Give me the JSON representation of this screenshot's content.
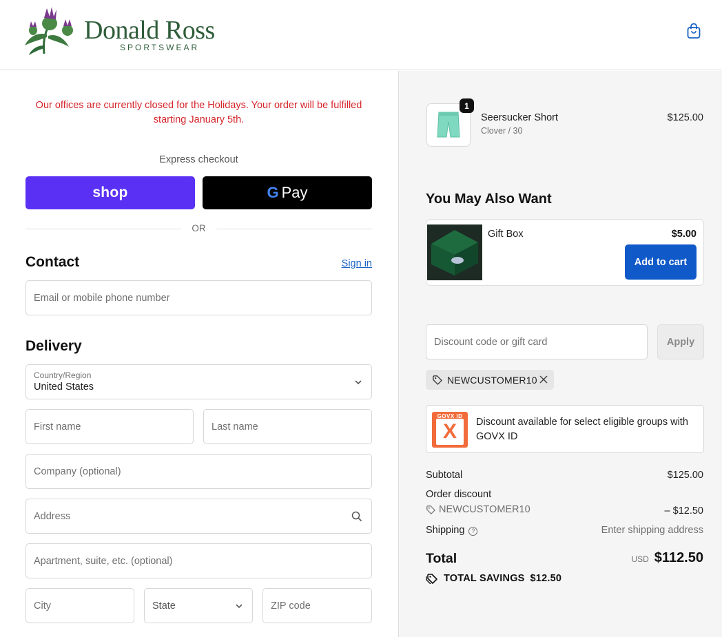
{
  "header": {
    "brand_name": "Donald Ross",
    "brand_sub": "SPORTSWEAR",
    "cart_icon": "shopping-bag-icon"
  },
  "notice": "Our offices are currently closed for the Holidays. Your order will be fulfilled starting January 5th.",
  "express": {
    "label": "Express checkout",
    "shop_label": "shop",
    "gpay_label": "Pay",
    "gpay_g": "G",
    "divider": "OR"
  },
  "contact": {
    "title": "Contact",
    "signin": "Sign in",
    "email_placeholder": "Email or mobile phone number"
  },
  "delivery": {
    "title": "Delivery",
    "country_label": "Country/Region",
    "country_value": "United States",
    "first_name": "First name",
    "last_name": "Last name",
    "company": "Company (optional)",
    "address": "Address",
    "apartment": "Apartment, suite, etc. (optional)",
    "city": "City",
    "state": "State",
    "zip": "ZIP code"
  },
  "cart_item": {
    "name": "Seersucker Short",
    "variant": "Clover / 30",
    "price": "$125.00",
    "quantity": "1"
  },
  "upsell": {
    "title": "You May Also Want",
    "name": "Gift Box",
    "price": "$5.00",
    "button": "Add to cart"
  },
  "discount": {
    "placeholder": "Discount code or gift card",
    "apply": "Apply",
    "applied_code": "NEWCUSTOMER10"
  },
  "govx": {
    "badge_top": "GOVX ID",
    "badge_mark": "X",
    "text": "Discount available for select eligible groups with GOVX ID"
  },
  "summary": {
    "subtotal_label": "Subtotal",
    "subtotal_value": "$125.00",
    "order_discount_label": "Order discount",
    "discount_code": "NEWCUSTOMER10",
    "discount_value": "– $12.50",
    "shipping_label": "Shipping",
    "shipping_value": "Enter shipping address",
    "total_label": "Total",
    "currency": "USD",
    "total_value": "$112.50",
    "savings_label": "TOTAL SAVINGS",
    "savings_value": "$12.50"
  },
  "colors": {
    "shop_purple": "#5a31f4",
    "notice_red": "#d5252b",
    "link_blue": "#1a62c4",
    "add_blue": "#1059c8",
    "brand_green": "#2f5d3a",
    "govx_orange": "#f26b3a"
  }
}
